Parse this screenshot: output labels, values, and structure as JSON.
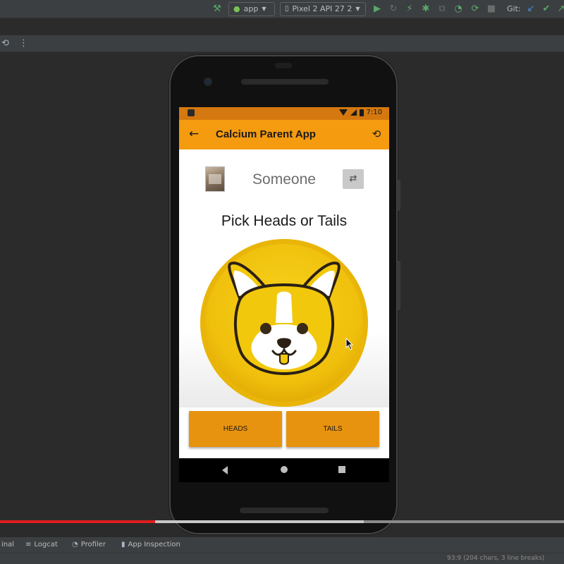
{
  "ide": {
    "toolbar": {
      "run_config": "app",
      "device": "Pixel 2 API 27 2",
      "git_label": "Git:"
    },
    "bottom_tabs": [
      "inal",
      "Logcat",
      "Profiler",
      "App Inspection"
    ],
    "status_text": "93:9 (204 chars, 3 line breaks)"
  },
  "app": {
    "status_time": "7:10",
    "title": "Calcium Parent App",
    "user_name": "Someone",
    "prompt": "Pick Heads or Tails",
    "buttons": {
      "heads": "HEADS",
      "tails": "TAILS"
    }
  },
  "video": {
    "progress_fraction": 0.275,
    "buffered_fraction": 0.645
  },
  "colors": {
    "app_bar": "#f49b10",
    "status_bar": "#d4780f",
    "button": "#e8930f",
    "coin": "#f2c20f",
    "progress": "#e01e1e"
  }
}
